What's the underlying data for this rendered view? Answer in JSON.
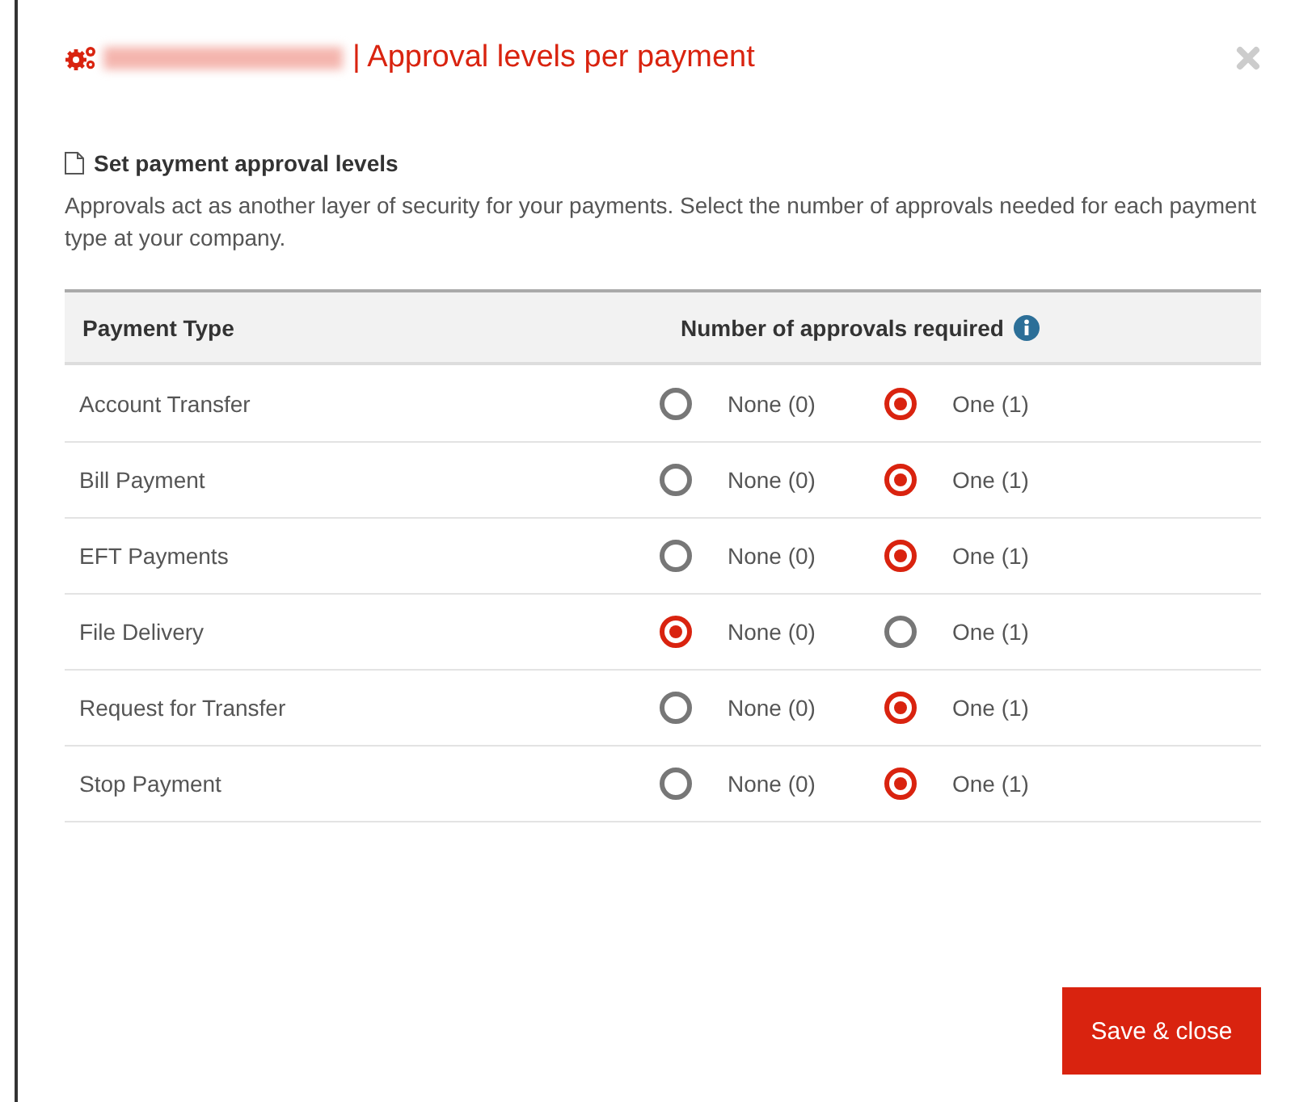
{
  "dialog": {
    "title": "| Approval levels per payment"
  },
  "section": {
    "heading": "Set payment approval levels",
    "description": "Approvals act as another layer of security for your payments. Select the number of approvals needed for each payment type at your company."
  },
  "table": {
    "columns": [
      "Payment Type",
      "Number of approvals required"
    ],
    "rows": [
      {
        "type": "Account Transfer",
        "options": [
          {
            "label": "None (0)",
            "selected": false
          },
          {
            "label": "One (1)",
            "selected": true
          }
        ]
      },
      {
        "type": "Bill Payment",
        "options": [
          {
            "label": "None (0)",
            "selected": false
          },
          {
            "label": "One (1)",
            "selected": true
          }
        ]
      },
      {
        "type": "EFT Payments",
        "options": [
          {
            "label": "None (0)",
            "selected": false
          },
          {
            "label": "One (1)",
            "selected": true
          }
        ]
      },
      {
        "type": "File Delivery",
        "options": [
          {
            "label": "None (0)",
            "selected": true
          },
          {
            "label": "One (1)",
            "selected": false
          }
        ]
      },
      {
        "type": "Request for Transfer",
        "options": [
          {
            "label": "None (0)",
            "selected": false
          },
          {
            "label": "One (1)",
            "selected": true
          }
        ]
      },
      {
        "type": "Stop Payment",
        "options": [
          {
            "label": "None (0)",
            "selected": false
          },
          {
            "label": "One (1)",
            "selected": true
          }
        ]
      }
    ]
  },
  "buttons": [
    "Save & close"
  ]
}
